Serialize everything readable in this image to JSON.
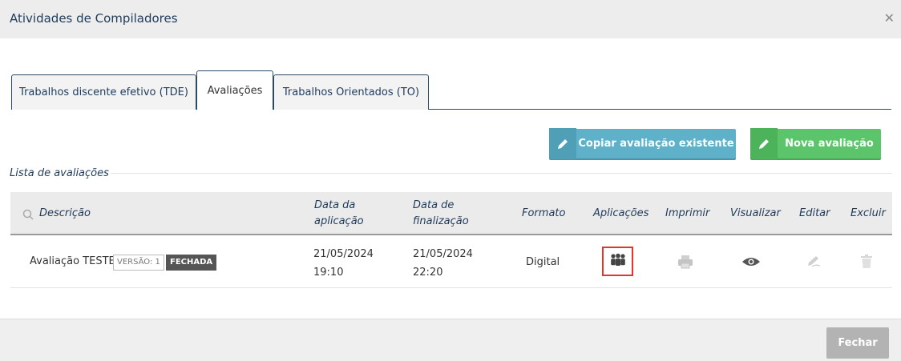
{
  "modal": {
    "title": "Atividades de Compiladores",
    "close_icon": "close-icon"
  },
  "tabs": [
    {
      "label": "Trabalhos discente efetivo (TDE)"
    },
    {
      "label": "Avaliações",
      "active": true
    },
    {
      "label": "Trabalhos Orientados (TO)"
    }
  ],
  "actions": {
    "copy_label": "Copiar avaliação existente",
    "new_label": "Nova avaliação",
    "icon": "pencil-icon",
    "copy_color": "#5fb1c9",
    "new_color": "#5cc46a"
  },
  "list": {
    "title": "Lista de avaliações",
    "headers": {
      "descricao": "Descrição",
      "data_aplicacao_1": "Data da",
      "data_aplicacao_2": "aplicação",
      "data_finalizacao_1": "Data de",
      "data_finalizacao_2": "finalização",
      "formato": "Formato",
      "aplicacoes": "Aplicações",
      "imprimir": "Imprimir",
      "visualizar": "Visualizar",
      "editar": "Editar",
      "excluir": "Excluir"
    },
    "rows": [
      {
        "descricao": "Avaliação TESTE",
        "versao": "VERSÃO: 1",
        "status": "FECHADA",
        "data_aplicacao": "21/05/2024",
        "hora_aplicacao": "19:10",
        "data_finalizacao": "21/05/2024",
        "hora_finalizacao": "22:20",
        "formato": "Digital"
      }
    ]
  },
  "footer": {
    "close_label": "Fechar"
  },
  "colors": {
    "title_text": "#1f3b5a",
    "highlight": "#e0362b",
    "status_badge": "#555555"
  }
}
